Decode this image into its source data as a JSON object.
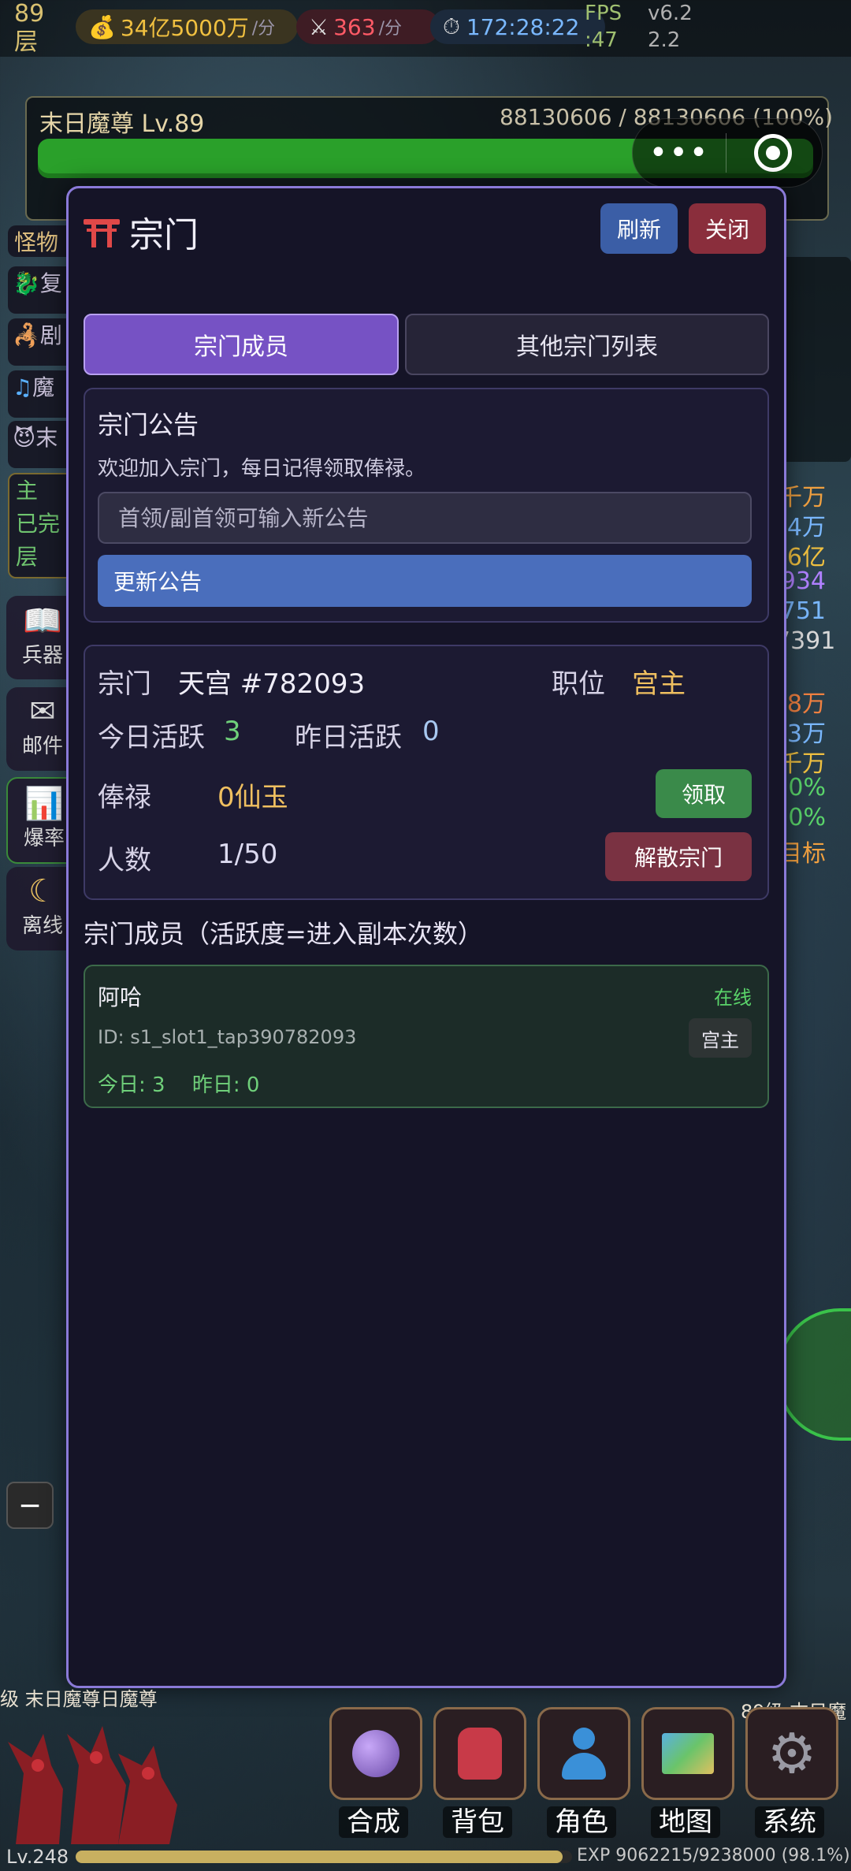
{
  "top": {
    "floor_label": "89\n层",
    "gold": "34亿5000万",
    "gold_unit": "/分",
    "kills": "363",
    "kills_unit": "/分",
    "timer": "172:28:22",
    "fps": "FPS\n:47",
    "version": "v6.2\n2.2"
  },
  "boss": {
    "name": "末日魔尊 Lv.89",
    "hp_text": "88130606 / 88130606 (100%)",
    "hp_percent": 100
  },
  "left_panel": {
    "monster_tab": "怪物 ",
    "rows": [
      "复",
      "剧",
      "魔",
      "末"
    ],
    "quest": "主\n已完\n层",
    "buttons": [
      "兵器",
      "邮件",
      "爆率",
      "离线"
    ]
  },
  "right_panel": {
    "values": [
      "千万",
      "4万",
      "6亿",
      "934",
      "751",
      "7391",
      "8万",
      "3万",
      "千万",
      "0%",
      "0%",
      "目标"
    ]
  },
  "modal": {
    "title": "宗门",
    "refresh_label": "刷新",
    "close_label": "关闭",
    "tabs": [
      "宗门成员",
      "其他宗门列表"
    ],
    "notice": {
      "title": "宗门公告",
      "text": "欢迎加入宗门，每日记得领取俸禄。",
      "input_placeholder": "首领/副首领可输入新公告",
      "update_label": "更新公告"
    },
    "info": {
      "sect_label": "宗门",
      "sect_name": "天宫 #782093",
      "position_label": "职位",
      "position_value": "宫主",
      "today_label": "今日活跃",
      "today_value": "3",
      "yesterday_label": "昨日活跃",
      "yesterday_value": "0",
      "salary_label": "俸禄",
      "salary_value": "0仙玉",
      "claim_label": "领取",
      "members_label": "人数",
      "members_value": "1/50",
      "disband_label": "解散宗门"
    },
    "members_heading": "宗门成员（活跃度=进入副本次数）",
    "members": [
      {
        "name": "阿哈",
        "status": "在线",
        "id": "ID: s1_slot1_tap390782093",
        "role": "宫主",
        "stats": "今日: 3  昨日: 0"
      }
    ]
  },
  "nav": [
    "合成",
    "背包",
    "角色",
    "地图",
    "系统"
  ],
  "footer": {
    "level": "Lv.248",
    "exp": "EXP 9062215/9238000 (98.1%)",
    "exp_percent": 98.1,
    "mob_left": "级 末日魔尊日魔尊",
    "mob_right": "89级 末日魔"
  },
  "colors": {
    "accent": "#7652c4",
    "modal_border": "#8a7ad8",
    "hp_green": "#2aa02a",
    "gold": "#f0c040",
    "online": "#5ad46a"
  }
}
